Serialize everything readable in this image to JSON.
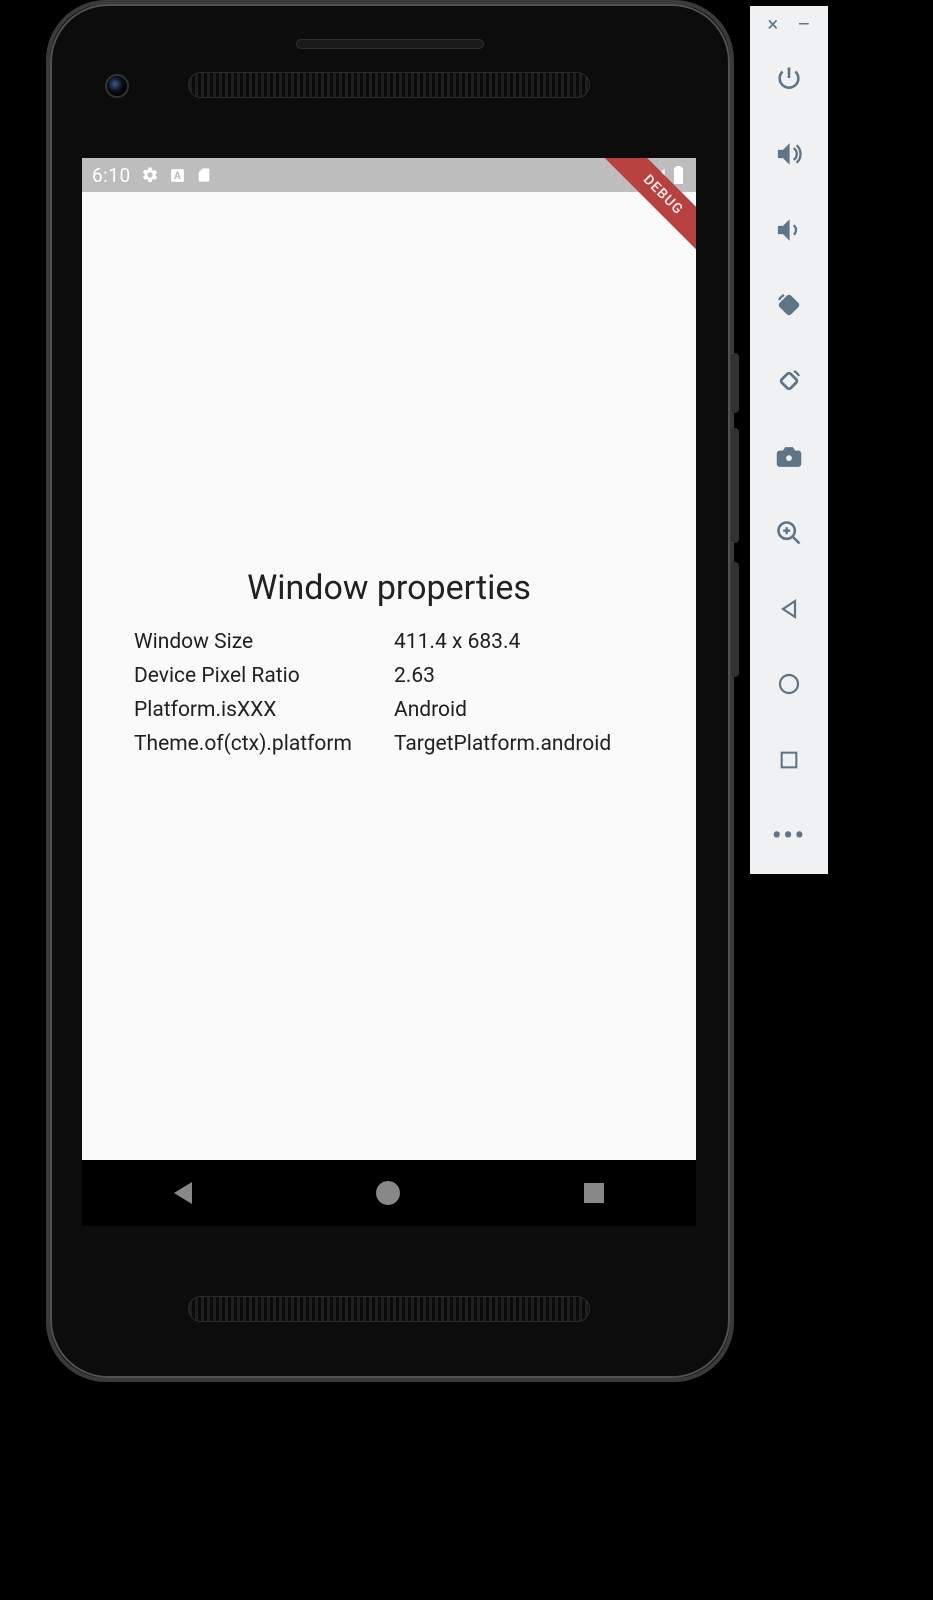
{
  "statusbar": {
    "time": "6:10",
    "icons": [
      "settings-icon",
      "language-icon",
      "sd-card-icon"
    ],
    "right_icons": [
      "wifi-icon",
      "signal-icon",
      "battery-icon"
    ]
  },
  "debug_banner": "DEBUG",
  "content": {
    "title": "Window properties",
    "rows": [
      {
        "label": "Window Size",
        "value": "411.4 x 683.4"
      },
      {
        "label": "Device Pixel Ratio",
        "value": "2.63"
      },
      {
        "label": "Platform.isXXX",
        "value": "Android"
      },
      {
        "label": "Theme.of(ctx).platform",
        "value": "TargetPlatform.android"
      }
    ]
  },
  "emulator_controls": {
    "window": {
      "close": "×",
      "minimize": "–"
    },
    "buttons": [
      "power",
      "volume-up",
      "volume-down",
      "rotate-left",
      "rotate-right",
      "screenshot",
      "zoom",
      "back",
      "home",
      "overview",
      "more"
    ]
  }
}
